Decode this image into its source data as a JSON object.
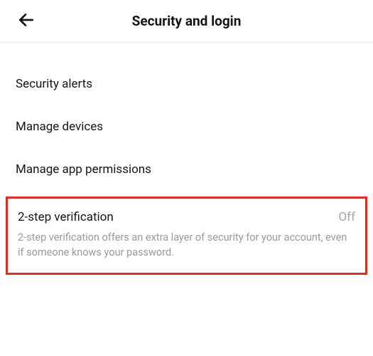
{
  "header": {
    "title": "Security and login"
  },
  "menu": {
    "security_alerts": "Security alerts",
    "manage_devices": "Manage devices",
    "manage_app_permissions": "Manage app permissions"
  },
  "two_step": {
    "label": "2-step verification",
    "status": "Off",
    "description": "2-step verification offers an extra layer of security for your account, even if someone knows your password."
  }
}
